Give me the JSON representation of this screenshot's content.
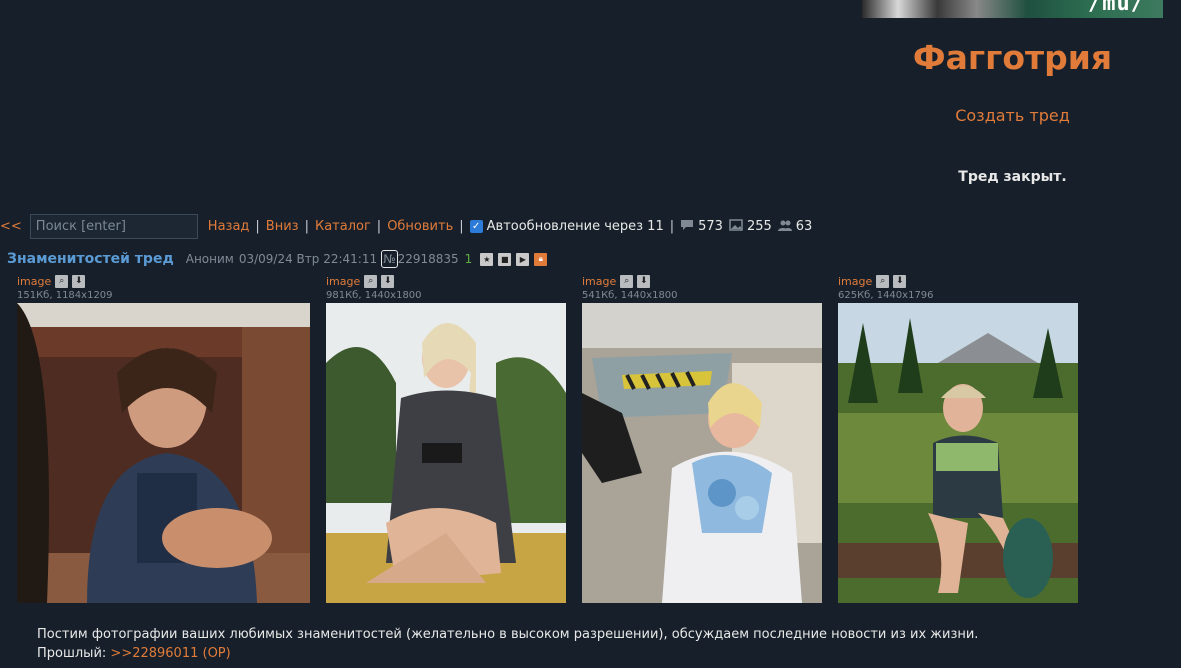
{
  "banner": {
    "text": "/mu/"
  },
  "board": {
    "title": "Фагготрия",
    "create_thread": "Создать тред",
    "thread_closed": "Тред закрыт."
  },
  "toolbar": {
    "back_arrows": "<<",
    "search_placeholder": "Поиск [enter]",
    "back": "Назад",
    "down": "Вниз",
    "catalog": "Каталог",
    "refresh": "Обновить",
    "autorefresh": "Автообновление через 11",
    "autorefresh_checked": true,
    "posts_count": "573",
    "images_count": "255",
    "posters_count": "63"
  },
  "post": {
    "subject": "Знаменитостей тред",
    "name": "Аноним",
    "date": "03/09/24 Втр 22:41:11",
    "num_prefix": "№",
    "number": "22918835",
    "order": "1",
    "body_line1": "Постим фотографии ваших любимых знаменитостей (желательно в высоком разрешении), обсуждаем последние новости из их жизни.",
    "body_line2_prefix": "Прошлый:",
    "body_link": ">>22896011 (OP)"
  },
  "images": [
    {
      "name": "image",
      "info": "151Кб, 1184x1209"
    },
    {
      "name": "image",
      "info": "981Кб, 1440x1800"
    },
    {
      "name": "image",
      "info": "541Кб, 1440x1800"
    },
    {
      "name": "image",
      "info": "625Кб, 1440x1796"
    }
  ],
  "colors": {
    "accent": "#e07b3a",
    "link_blue": "#5b9bd5",
    "background": "#17202a"
  }
}
